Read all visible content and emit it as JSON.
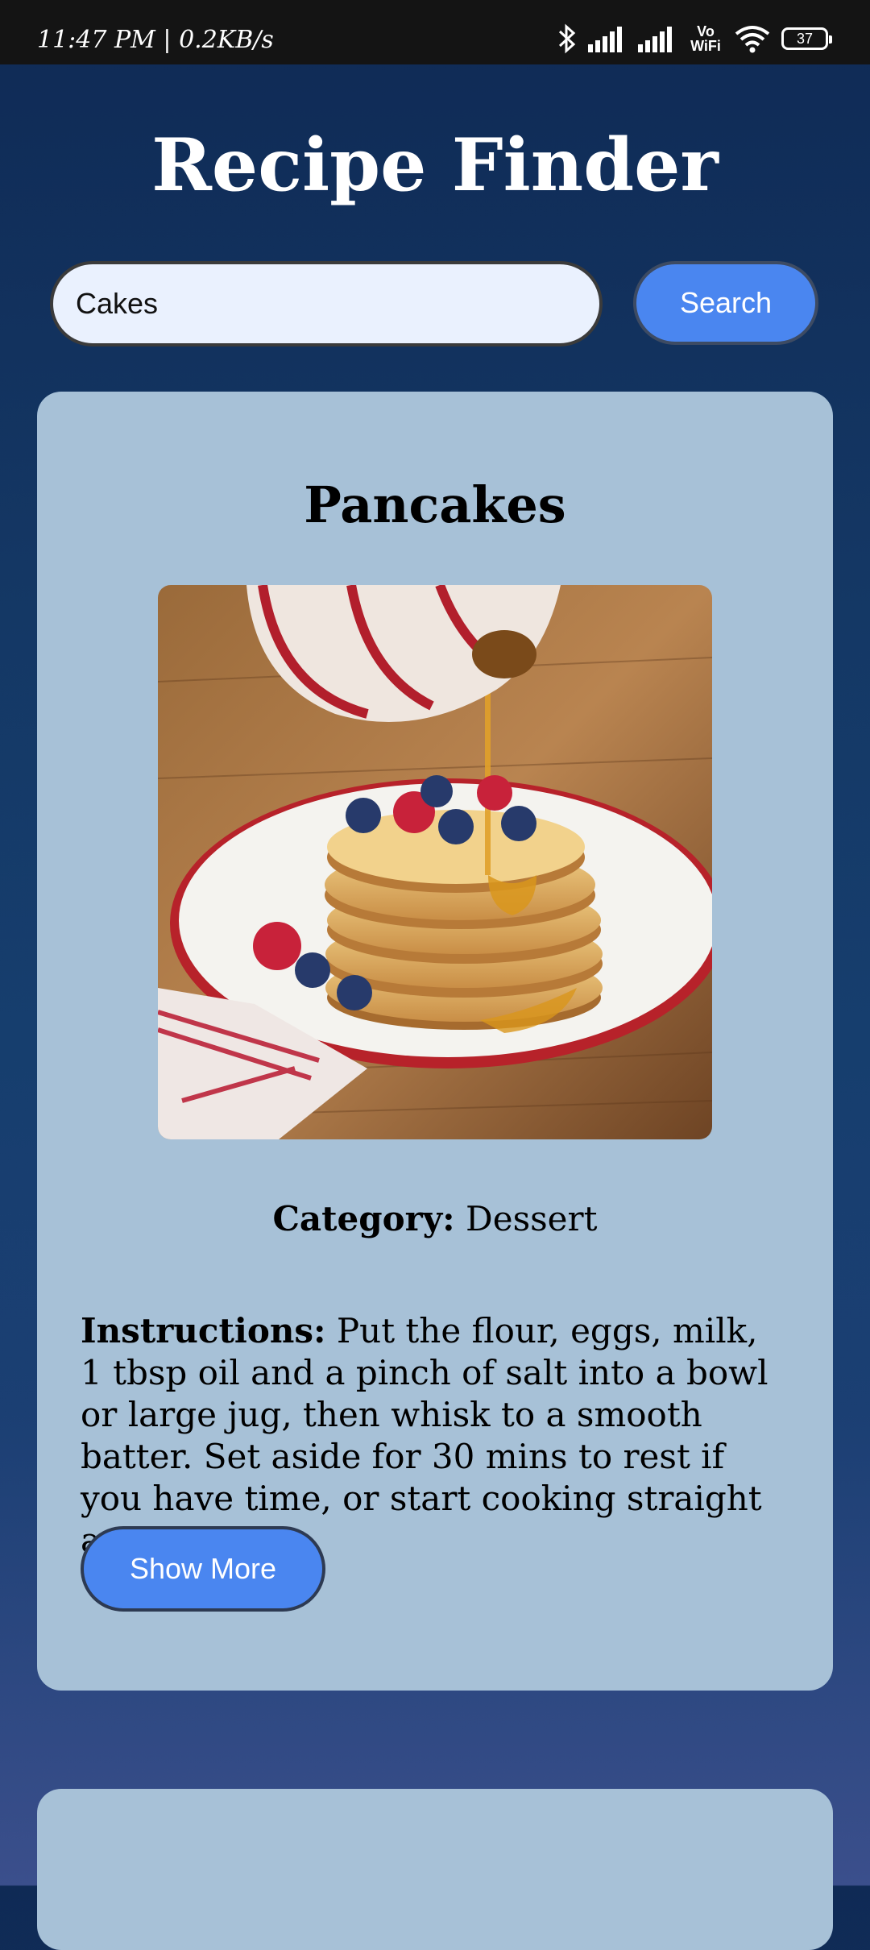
{
  "status_bar": {
    "time_speed": "11:47 PM | 0.2KB/s",
    "wifi_label_top": "Vo",
    "wifi_label_bottom": "WiFi",
    "battery": "37",
    "icons": [
      "bluetooth-icon",
      "signal-icon",
      "signal-icon",
      "vowifi-icon",
      "wifi-icon",
      "battery-icon"
    ]
  },
  "app": {
    "title": "Recipe Finder"
  },
  "search": {
    "value": "Cakes",
    "button_label": "Search"
  },
  "recipes": [
    {
      "title": "Pancakes",
      "category_label": "Category:",
      "category": "Dessert",
      "instructions_label": "Instructions:",
      "instructions": "Put the flour, eggs, milk, 1 tbsp oil and a pinch of salt into a bowl or large jug, then whisk to a smooth batter. Set aside for 30 mins to rest if you have time, or start cooking straight away. Set ...",
      "show_more_label": "Show More"
    }
  ],
  "colors": {
    "accent_button": "#4a86f0",
    "card": "#a7c1d7",
    "search_field": "#eaf1fe"
  }
}
